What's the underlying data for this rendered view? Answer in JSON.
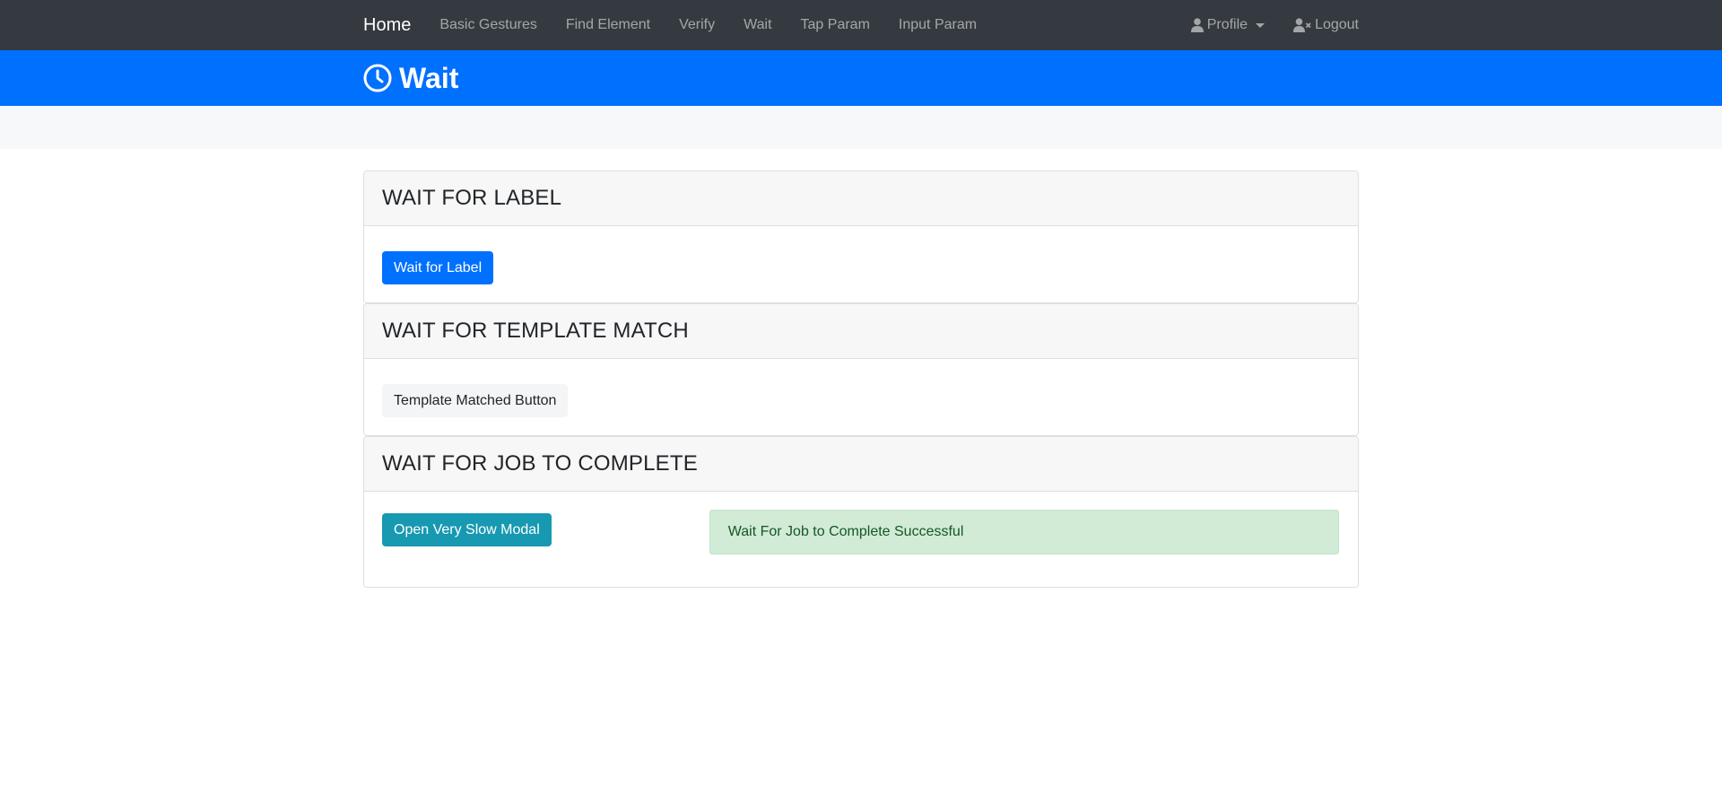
{
  "navbar": {
    "brand": "Home",
    "links": [
      "Basic Gestures",
      "Find Element",
      "Verify",
      "Wait",
      "Tap Param",
      "Input Param"
    ],
    "profile_label": "Profile",
    "logout_label": "Logout",
    "background": "#343a40"
  },
  "header": {
    "title": "Wait",
    "icon": "clock-icon",
    "background": "#0070ff"
  },
  "sections": {
    "wait_label": {
      "title": "WAIT FOR LABEL",
      "button_label": "Wait for Label"
    },
    "template_match": {
      "title": "WAIT FOR TEMPLATE MATCH",
      "button_label": "Template Matched Button"
    },
    "job_complete": {
      "title": "WAIT FOR JOB TO COMPLETE",
      "button_label": "Open Very Slow Modal",
      "status_message": "Wait For Job to Complete Successful"
    }
  },
  "colors": {
    "primary": "#0070ff",
    "info": "#1799b1",
    "success_bg": "#d1ebd6",
    "success_text": "#155724"
  }
}
